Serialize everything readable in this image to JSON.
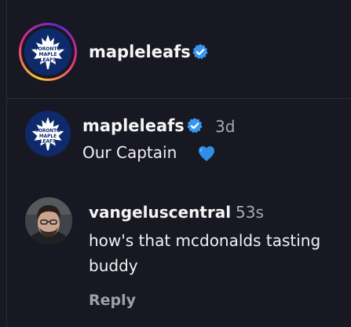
{
  "header": {
    "username": "mapleleafs",
    "avatar": "maple-leafs-logo",
    "verified_icon": "verified-badge-icon",
    "story_ring": true
  },
  "post": {
    "username": "mapleleafs",
    "avatar": "maple-leafs-logo",
    "verified_icon": "verified-badge-icon",
    "time": "3d",
    "caption": "Our Captain",
    "caption_emoji": "blue-heart-icon"
  },
  "comment": {
    "username": "vangeluscentral",
    "avatar": "user-photo-avatar",
    "time": "53s",
    "text": "how's that mcdonalds tasting\nbuddy",
    "reply_label": "Reply"
  },
  "colors": {
    "background": "#171822",
    "verified_blue": "#3897f0",
    "heart_blue": "#2f8fe8",
    "logo_navy": "#0f2a6b"
  }
}
